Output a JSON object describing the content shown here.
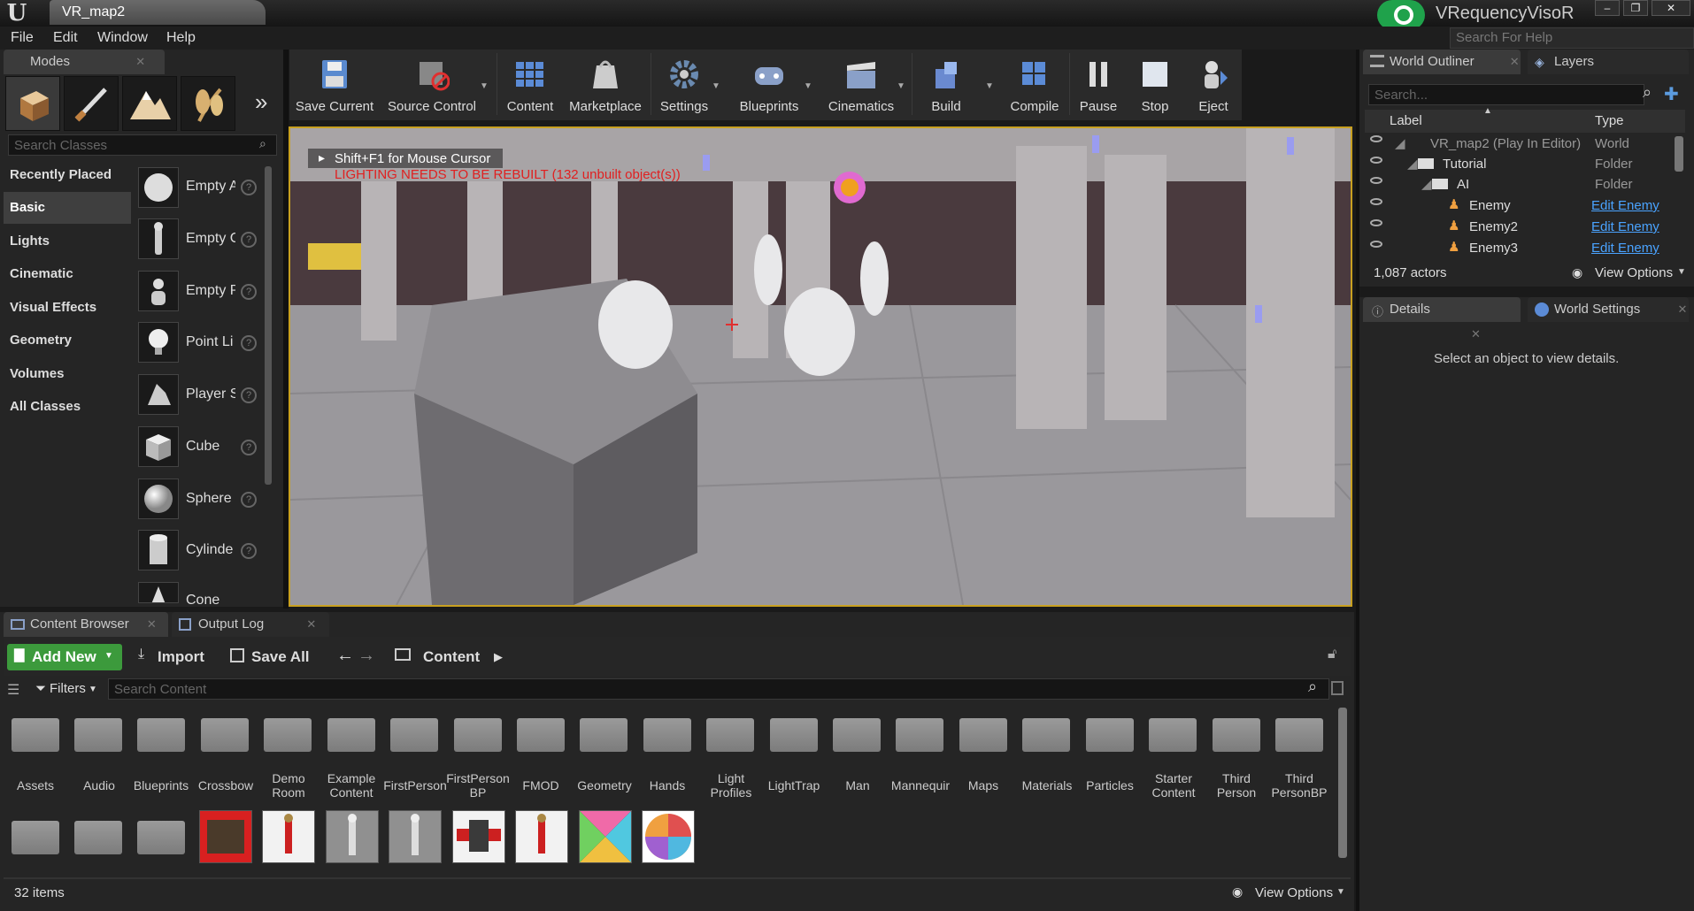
{
  "app": {
    "title": "VRequencyVisoR",
    "document_tab": "VR_map2",
    "help_search_placeholder": "Search For Help",
    "window_buttons": [
      "–",
      "❐",
      "✕"
    ]
  },
  "menu": [
    "File",
    "Edit",
    "Window",
    "Help"
  ],
  "modes": {
    "tab": "Modes",
    "search_placeholder": "Search Classes",
    "mode_icons": [
      "place-mode-icon",
      "paint-mode-icon",
      "landscape-mode-icon",
      "foliage-mode-icon",
      "more-modes-icon"
    ],
    "categories": [
      "Recently Placed",
      "Basic",
      "Lights",
      "Cinematic",
      "Visual Effects",
      "Geometry",
      "Volumes",
      "All Classes"
    ],
    "selected_category": "Basic",
    "items": [
      "Empty A",
      "Empty C",
      "Empty P",
      "Point Li",
      "Player S",
      "Cube",
      "Sphere",
      "Cylinde",
      "Cone"
    ]
  },
  "toolbar": [
    "Save Current",
    "Source Control",
    "Content",
    "Marketplace",
    "Settings",
    "Blueprints",
    "Cinematics",
    "Build",
    "Compile",
    "Pause",
    "Stop",
    "Eject"
  ],
  "viewport": {
    "hint": "Shift+F1 for Mouse Cursor",
    "warning": "LIGHTING NEEDS TO BE REBUILT (132 unbuilt object(s))"
  },
  "outliner": {
    "tabs": [
      "World Outliner",
      "Layers"
    ],
    "search_placeholder": "Search...",
    "columns": [
      "Label",
      "Type"
    ],
    "rows": [
      {
        "label": "VR_map2 (Play In Editor)",
        "type": "World"
      },
      {
        "label": "Tutorial",
        "type": "Folder"
      },
      {
        "label": "AI",
        "type": "Folder"
      },
      {
        "label": "Enemy",
        "type": "Edit Enemy"
      },
      {
        "label": "Enemy2",
        "type": "Edit Enemy"
      },
      {
        "label": "Enemy3",
        "type": "Edit Enemy"
      }
    ],
    "count": "1,087 actors",
    "view_options": "View Options"
  },
  "details": {
    "tabs": [
      "Details",
      "World Settings"
    ],
    "empty_message": "Select an object to view details."
  },
  "content_browser": {
    "tabs": [
      "Content Browser",
      "Output Log"
    ],
    "add_new": "Add New",
    "import": "Import",
    "save_all": "Save All",
    "path": "Content",
    "filters": "Filters",
    "search_placeholder": "Search Content",
    "folders": [
      "Assets",
      "Audio",
      "Blueprints",
      "Crossbow",
      "Demo Room",
      "Example Content",
      "FirstPerson",
      "FirstPerson BP",
      "FMOD",
      "Geometry",
      "Hands",
      "Light Profiles",
      "LightTrap",
      "Man",
      "Mannequir",
      "Maps",
      "Materials",
      "Particles",
      "Starter Content",
      "Third Person",
      "Third PersonBP"
    ],
    "count": "32 items",
    "view_options": "View Options"
  },
  "colors": {
    "accent_yellow": "#c8a020",
    "add_new_green": "#3c9a3c",
    "link_blue": "#4aa3ff",
    "warning_red": "#e02020"
  }
}
